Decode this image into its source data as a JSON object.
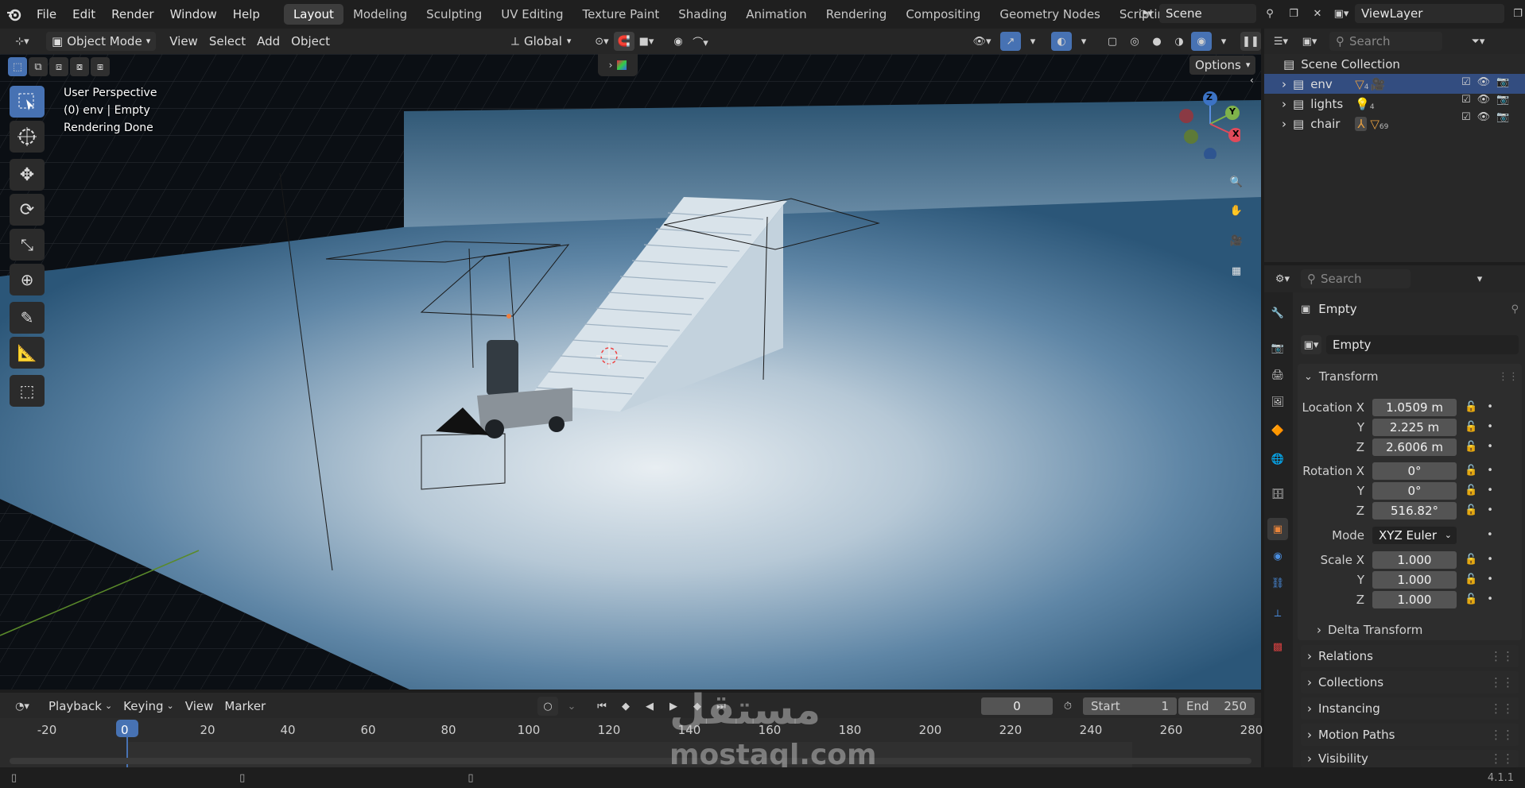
{
  "menu": {
    "file": "File",
    "edit": "Edit",
    "render": "Render",
    "window": "Window",
    "help": "Help"
  },
  "workspaces": [
    "Layout",
    "Modeling",
    "Sculpting",
    "UV Editing",
    "Texture Paint",
    "Shading",
    "Animation",
    "Rendering",
    "Compositing",
    "Geometry Nodes",
    "Scripting"
  ],
  "active_workspace": "Layout",
  "scene": {
    "name": "Scene",
    "view_layer": "ViewLayer"
  },
  "viewport_header": {
    "mode": "Object Mode",
    "view": "View",
    "select": "Select",
    "add": "Add",
    "object": "Object",
    "orientation": "Global",
    "options": "Options"
  },
  "viewport_overlay": {
    "perspective": "User Perspective",
    "context": "(0) env | Empty",
    "status": "Rendering Done"
  },
  "gizmo": {
    "z": "Z",
    "y": "Y",
    "x": "X"
  },
  "outliner": {
    "search_placeholder": "Search",
    "root": "Scene Collection",
    "items": [
      {
        "name": "env",
        "count": "4"
      },
      {
        "name": "lights",
        "count": "4"
      },
      {
        "name": "chair",
        "count": "69"
      }
    ]
  },
  "properties": {
    "search_placeholder": "Search",
    "object_name": "Empty",
    "data_name": "Empty",
    "transform_label": "Transform",
    "location_label": "Location X",
    "y_label": "Y",
    "z_label": "Z",
    "location": {
      "x": "1.0509 m",
      "y": "2.225 m",
      "z": "2.6006 m"
    },
    "rotation_label": "Rotation X",
    "rotation": {
      "x": "0°",
      "y": "0°",
      "z": "516.82°"
    },
    "mode_label": "Mode",
    "mode_value": "XYZ Euler",
    "scale_label": "Scale X",
    "scale": {
      "x": "1.000",
      "y": "1.000",
      "z": "1.000"
    },
    "sections": [
      "Delta Transform",
      "Relations",
      "Collections",
      "Instancing",
      "Motion Paths",
      "Visibility"
    ]
  },
  "timeline": {
    "playback": "Playback",
    "keying": "Keying",
    "view": "View",
    "marker": "Marker",
    "current_frame": "0",
    "start_label": "Start",
    "start": "1",
    "end_label": "End",
    "end": "250",
    "ticks": [
      "-20",
      "0",
      "20",
      "40",
      "60",
      "80",
      "100",
      "120",
      "140",
      "160",
      "180",
      "200",
      "220",
      "240",
      "260",
      "280"
    ]
  },
  "watermark": {
    "arabic": "مستقل",
    "latin": "mostaql.com"
  },
  "version": "4.1.1",
  "colors": {
    "accent": "#4772b3",
    "active_row": "#334d80",
    "bg": "#1d1d1d"
  }
}
